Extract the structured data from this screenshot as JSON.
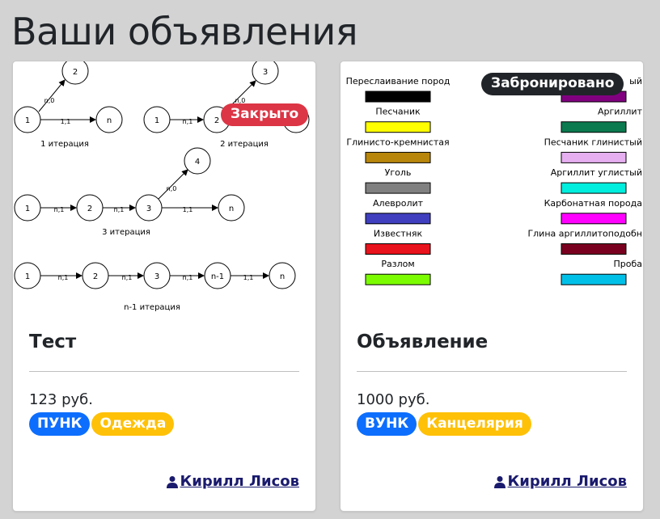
{
  "page": {
    "title": "Ваши объявления"
  },
  "cards": [
    {
      "status": "Закрыто",
      "title": "Тест",
      "price": "123 руб.",
      "tags": [
        "ПУНК",
        "Одежда"
      ],
      "author": "Кирилл Лисов",
      "image": {
        "nodes": [
          "1",
          "2",
          "n",
          "1",
          "2",
          "3",
          "1",
          "2",
          "3",
          "4",
          "n",
          "1",
          "2",
          "3",
          "n-1",
          "n"
        ],
        "edges": [
          "n,0",
          "1,1",
          "n,1",
          "n,0",
          "n,1",
          "n,1",
          "n,0",
          "1,1",
          "n,1",
          "n,1",
          "n,1",
          "1,1"
        ],
        "captions": [
          "1 итерация",
          "2 итерация",
          "3 итерация",
          "n-1 итерация"
        ]
      }
    },
    {
      "status": "Забронировано",
      "title": "Объявление",
      "price": "1000 руб.",
      "tags": [
        "ВУНК",
        "Канцелярия"
      ],
      "author": "Кирилл Лисов",
      "image": {
        "legend_left": [
          {
            "label": "Переслаивание пород",
            "color": "#000000"
          },
          {
            "label": "Песчаник",
            "color": "#ffff00"
          },
          {
            "label": "Глинисто-кремнистая",
            "color": "#b8860b"
          },
          {
            "label": "Уголь",
            "color": "#808080"
          },
          {
            "label": "Алевролит",
            "color": "#3f3fbf"
          },
          {
            "label": "Известняк",
            "color": "#e8131c"
          },
          {
            "label": "Разлом",
            "color": "#7cfc00"
          }
        ],
        "legend_right": [
          {
            "label": "ый",
            "color": "#800080"
          },
          {
            "label": "Аргиллит",
            "color": "#0b7a4f"
          },
          {
            "label": "Песчаник глинистый",
            "color": "#e6b0f0"
          },
          {
            "label": "Аргиллит углистый",
            "color": "#00eedd"
          },
          {
            "label": "Карбонатная порода",
            "color": "#ff00ff"
          },
          {
            "label": "Глина аргиллитоподобн",
            "color": "#7a0020"
          },
          {
            "label": "Проба",
            "color": "#00c0e8"
          }
        ]
      }
    }
  ]
}
